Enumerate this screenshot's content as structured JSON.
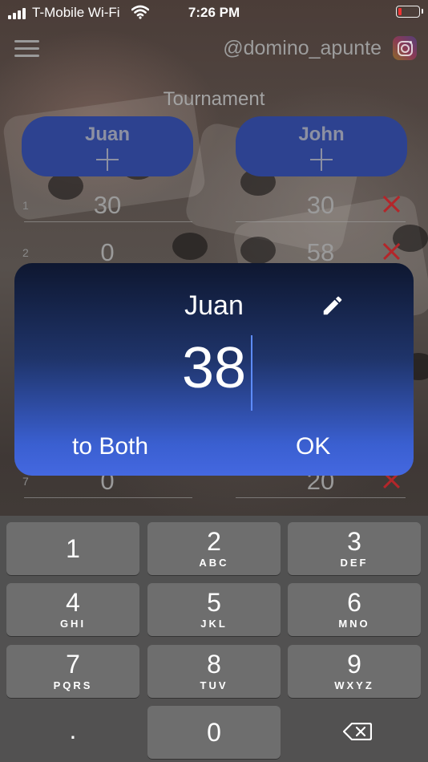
{
  "status_bar": {
    "carrier": "T-Mobile Wi-Fi",
    "time": "7:26 PM"
  },
  "header": {
    "handle": "@domino_apunte",
    "title": "Tournament",
    "menu_icon": "hamburger-menu-icon",
    "social_icon": "instagram-icon"
  },
  "players": [
    {
      "name": "Juan"
    },
    {
      "name": "John"
    }
  ],
  "rows": [
    {
      "index": "1",
      "p1": "30",
      "p2": "30"
    },
    {
      "index": "2",
      "p1": "0",
      "p2": "58"
    },
    {
      "index": "7",
      "p1": "0",
      "p2": "20"
    }
  ],
  "dialog": {
    "player": "Juan",
    "value": "38",
    "to_both": "to Both",
    "ok": "OK"
  },
  "keyboard": {
    "keys": [
      {
        "num": "1",
        "sub": ""
      },
      {
        "num": "2",
        "sub": "ABC"
      },
      {
        "num": "3",
        "sub": "DEF"
      },
      {
        "num": "4",
        "sub": "GHI"
      },
      {
        "num": "5",
        "sub": "JKL"
      },
      {
        "num": "6",
        "sub": "MNO"
      },
      {
        "num": "7",
        "sub": "PQRS"
      },
      {
        "num": "8",
        "sub": "TUV"
      },
      {
        "num": "9",
        "sub": "WXYZ"
      },
      {
        "num": ".",
        "sub": ""
      },
      {
        "num": "0",
        "sub": ""
      }
    ]
  },
  "colors": {
    "accent": "#3a5fd0",
    "player_button": "#2d4290",
    "delete": "#b3262a",
    "battery_low": "#e33333"
  }
}
